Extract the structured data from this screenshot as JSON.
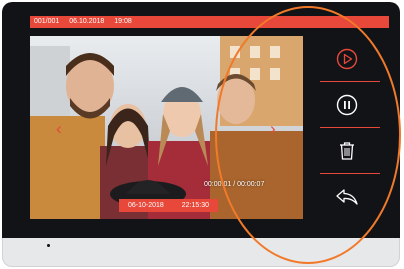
{
  "status_bar": {
    "record_index": "001/001",
    "date": "06.10.2018",
    "time": "19:08"
  },
  "playback": {
    "timecode": "00:00:01 / 00:00:07",
    "overlay_date": "06-10-2018",
    "overlay_time": "22:15:30"
  },
  "navigation": {
    "prev_icon": "chevron-left-icon",
    "prev_glyph": "‹",
    "next_icon": "chevron-right-icon",
    "next_glyph": "›"
  },
  "controls": [
    {
      "name": "play-button",
      "icon": "play-icon"
    },
    {
      "name": "pause-button",
      "icon": "pause-icon"
    },
    {
      "name": "delete-button",
      "icon": "trash-icon"
    },
    {
      "name": "back-button",
      "icon": "return-arrow-icon"
    }
  ],
  "colors": {
    "accent": "#e8483a",
    "bezel": "#121316",
    "highlight": "#f07a2a",
    "frame": "#e7e8ea"
  }
}
